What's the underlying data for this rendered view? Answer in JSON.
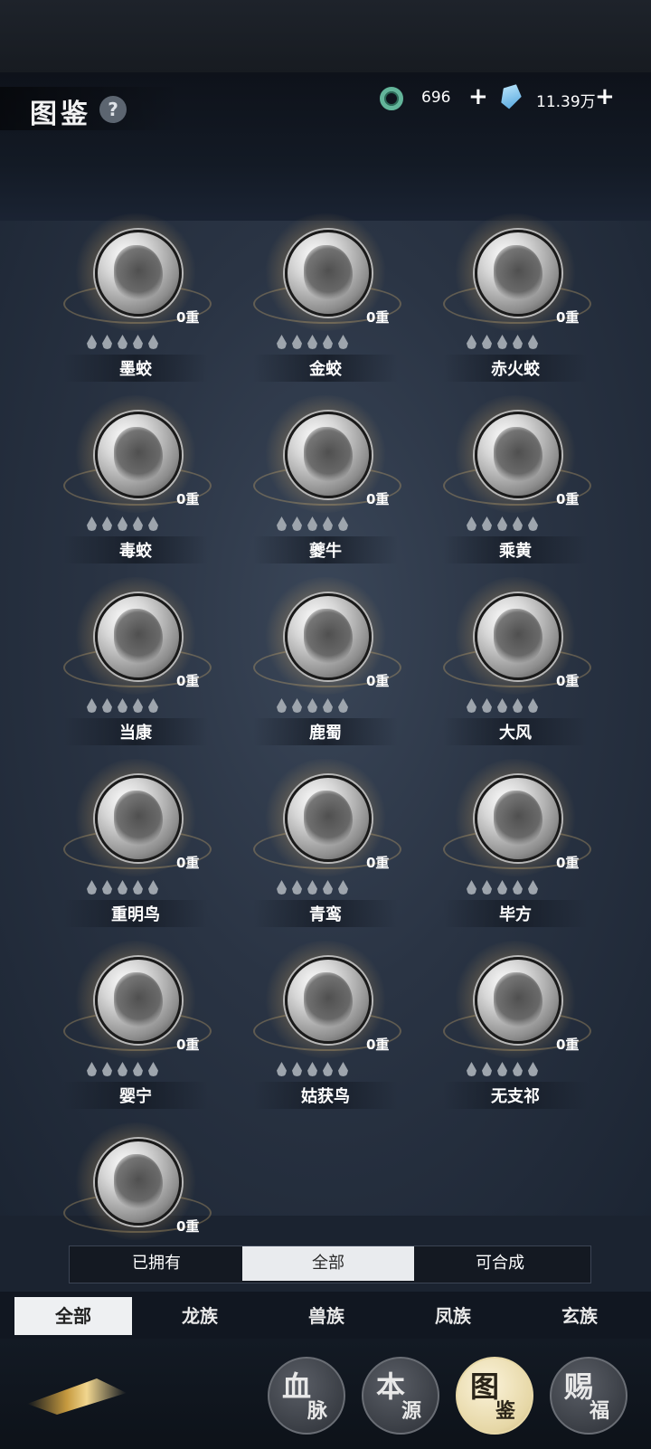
{
  "header": {
    "title": "图鉴",
    "help": "?",
    "resources": [
      {
        "icon": "jade-ring-icon",
        "value": "696",
        "plus": "+"
      },
      {
        "icon": "crystal-icon",
        "value": "11.39万",
        "plus": "+"
      }
    ]
  },
  "beasts": [
    {
      "name": "墨蛟",
      "tier": "0重"
    },
    {
      "name": "金蛟",
      "tier": "0重"
    },
    {
      "name": "赤火蛟",
      "tier": "0重"
    },
    {
      "name": "毒蛟",
      "tier": "0重"
    },
    {
      "name": "夔牛",
      "tier": "0重"
    },
    {
      "name": "乘黄",
      "tier": "0重"
    },
    {
      "name": "当康",
      "tier": "0重"
    },
    {
      "name": "鹿蜀",
      "tier": "0重"
    },
    {
      "name": "大风",
      "tier": "0重"
    },
    {
      "name": "重明鸟",
      "tier": "0重"
    },
    {
      "name": "青鸾",
      "tier": "0重"
    },
    {
      "name": "毕方",
      "tier": "0重"
    },
    {
      "name": "婴宁",
      "tier": "0重"
    },
    {
      "name": "姑获鸟",
      "tier": "0重"
    },
    {
      "name": "无支祁",
      "tier": "0重"
    },
    {
      "name": "",
      "tier": "0重"
    }
  ],
  "filters": [
    "已拥有",
    "全部",
    "可合成"
  ],
  "active_filter": 1,
  "tabs": [
    "全部",
    "龙族",
    "兽族",
    "凤族",
    "玄族"
  ],
  "active_tab": 0,
  "nav": [
    {
      "main": "血",
      "sub": "脉"
    },
    {
      "main": "本",
      "sub": "源"
    },
    {
      "main": "图",
      "sub": "鉴"
    },
    {
      "main": "赐",
      "sub": "福"
    }
  ],
  "active_nav": 2
}
